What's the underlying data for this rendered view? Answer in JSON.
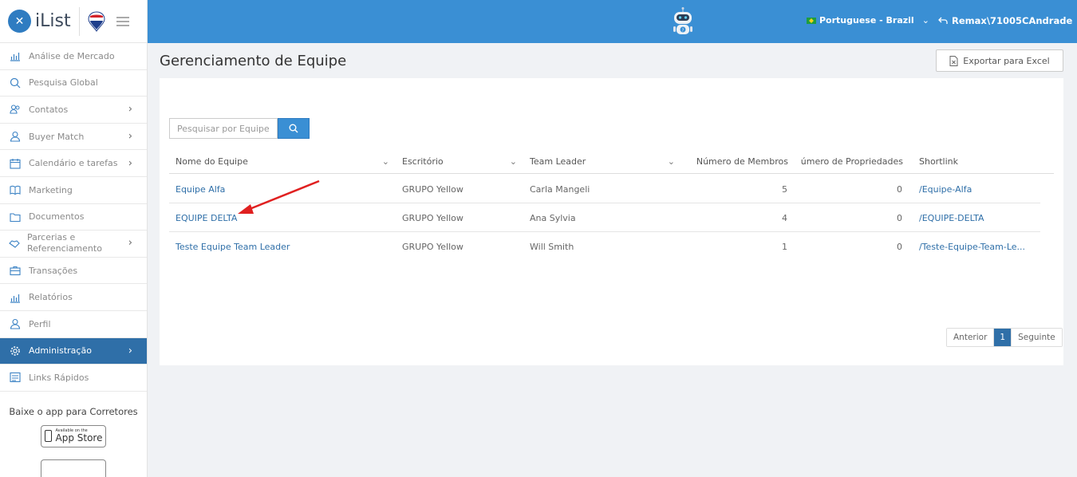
{
  "brand": {
    "name": "iList"
  },
  "sidebar": {
    "items": [
      {
        "label": "Análise de Mercado",
        "icon": "bar-chart-icon",
        "chevron": false
      },
      {
        "label": "Pesquisa Global",
        "icon": "search-icon",
        "chevron": false
      },
      {
        "label": "Contatos",
        "icon": "contacts-icon",
        "chevron": true
      },
      {
        "label": "Buyer Match",
        "icon": "user-icon",
        "chevron": true
      },
      {
        "label": "Calendário e tarefas",
        "icon": "calendar-icon",
        "chevron": true
      },
      {
        "label": "Marketing",
        "icon": "book-icon",
        "chevron": false
      },
      {
        "label": "Documentos",
        "icon": "folder-icon",
        "chevron": false
      },
      {
        "label": "Parcerias e Referenciamento",
        "icon": "handshake-icon",
        "chevron": true
      },
      {
        "label": "Transações",
        "icon": "briefcase-icon",
        "chevron": false
      },
      {
        "label": "Relatórios",
        "icon": "report-icon",
        "chevron": false
      },
      {
        "label": "Perfil",
        "icon": "profile-icon",
        "chevron": false
      },
      {
        "label": "Administração",
        "icon": "gear-icon",
        "chevron": true,
        "active": true
      },
      {
        "label": "Links Rápidos",
        "icon": "link-icon",
        "chevron": false
      }
    ],
    "app_title": "Baixe o app para Corretores",
    "app_store": {
      "small": "Available on the",
      "big": "App Store"
    }
  },
  "topbar": {
    "language": "Portuguese - Brazil",
    "user": "Remax\\71005CAndrade"
  },
  "page": {
    "title": "Gerenciamento de Equipe",
    "export_label": "Exportar para Excel",
    "search_placeholder": "Pesquisar por Equipe"
  },
  "table": {
    "headers": [
      "Nome do Equipe",
      "Escritório",
      "Team Leader",
      "Número de Membros",
      "úmero de Propriedades",
      "Shortlink"
    ],
    "rows": [
      {
        "name": "Equipe Alfa",
        "office": "GRUPO Yellow",
        "leader": "Carla Mangeli",
        "members": "5",
        "properties": "0",
        "shortlink": "/Equipe-Alfa"
      },
      {
        "name": "EQUIPE DELTA",
        "office": "GRUPO Yellow",
        "leader": "Ana Sylvia",
        "members": "4",
        "properties": "0",
        "shortlink": "/EQUIPE-DELTA"
      },
      {
        "name": "Teste Equipe Team Leader",
        "office": "GRUPO Yellow",
        "leader": "Will Smith",
        "members": "1",
        "properties": "0",
        "shortlink": "/Teste-Equipe-Team-Le..."
      }
    ]
  },
  "pagination": {
    "prev": "Anterior",
    "current": "1",
    "next": "Seguinte"
  },
  "colors": {
    "topbar": "#3a8fd4",
    "active": "#2f6fa8",
    "link": "#2f6fa8",
    "annotation_arrow": "#e02020"
  }
}
